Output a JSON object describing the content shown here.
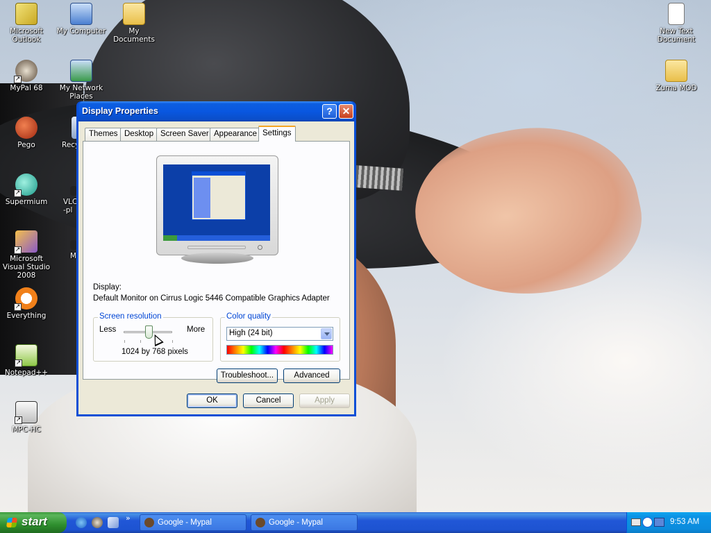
{
  "desktop": {
    "icons": [
      {
        "label": "Microsoft Outlook"
      },
      {
        "label": "My Computer"
      },
      {
        "label": "My Documents"
      },
      {
        "label": "MyPal 68"
      },
      {
        "label": "My Network Places"
      },
      {
        "label": "Pego"
      },
      {
        "label": "Recy"
      },
      {
        "label": "Supermium"
      },
      {
        "label": "VLC -pl"
      },
      {
        "label": "Microsoft Visual Studio 2008"
      },
      {
        "label": "M"
      },
      {
        "label": "Everything"
      },
      {
        "label": "Notepad++"
      },
      {
        "label": "MPC-HC"
      },
      {
        "label": "New Text Document"
      },
      {
        "label": "Zuma MOD"
      }
    ]
  },
  "dialog": {
    "title": "Display Properties",
    "help_glyph": "?",
    "close_glyph": "✕",
    "tabs": [
      {
        "label": "Themes"
      },
      {
        "label": "Desktop"
      },
      {
        "label": "Screen Saver"
      },
      {
        "label": "Appearance"
      },
      {
        "label": "Settings"
      }
    ],
    "active_tab": "Settings",
    "display_label": "Display:",
    "display_value": "Default Monitor on Cirrus Logic 5446 Compatible Graphics Adapter",
    "screen_resolution": {
      "legend": "Screen resolution",
      "less_label": "Less",
      "more_label": "More",
      "value_text": "1024 by 768 pixels"
    },
    "color_quality": {
      "legend": "Color quality",
      "selected": "High (24 bit)"
    },
    "troubleshoot_label": "Troubleshoot...",
    "advanced_label": "Advanced",
    "ok_label": "OK",
    "cancel_label": "Cancel",
    "apply_label": "Apply"
  },
  "taskbar": {
    "start_label": "start",
    "quicklaunch_chevron": "»",
    "tasks": [
      {
        "label": "Google - Mypal"
      },
      {
        "label": "Google - Mypal"
      }
    ],
    "clock": "9:53 AM"
  },
  "colors": {
    "title_blue": "#0a4fd6",
    "dialog_face": "#ece9d8",
    "groupbox_legend": "#0046d5",
    "start_green": "#3c9a3c",
    "tab_highlight": "#f5a623"
  }
}
